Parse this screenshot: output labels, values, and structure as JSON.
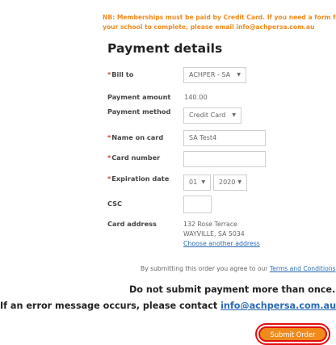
{
  "note": {
    "line1": "NB: Memberships must be paid by Credit Card. If you need a form for",
    "line2": "your school to complete, please email info@achpersa.com.au"
  },
  "heading": "Payment details",
  "fields": {
    "bill_to": {
      "label": "Bill to",
      "value": "ACHPER - SA"
    },
    "payment_amount": {
      "label": "Payment amount",
      "value": "140.00"
    },
    "payment_method": {
      "label": "Payment method",
      "value": "Credit Card"
    },
    "name_on_card": {
      "label": "Name on card",
      "value": "SA Test4"
    },
    "card_number": {
      "label": "Card number",
      "value": ""
    },
    "expiration_date": {
      "label": "Expiration date",
      "month": "01",
      "year": "2020"
    },
    "csc": {
      "label": "CSC",
      "value": ""
    },
    "card_address": {
      "label": "Card address",
      "line1": "132 Rose Terrace",
      "line2": "WAYVILLE, SA 5034",
      "change_link": "Choose another address"
    }
  },
  "agree": {
    "prefix": "By submitting this order you agree to our ",
    "link": "Terms and Conditions"
  },
  "warnings": {
    "line1": "Do not submit payment more than once.",
    "line2_prefix": "If an error message occurs, please contact ",
    "line2_link": "info@achpersa.com.au"
  },
  "submit_label": "Submit Order",
  "colors": {
    "accent": "#f08a1c",
    "link": "#2a6ab8",
    "required": "#e0392b",
    "highlight": "#e20f0f"
  }
}
